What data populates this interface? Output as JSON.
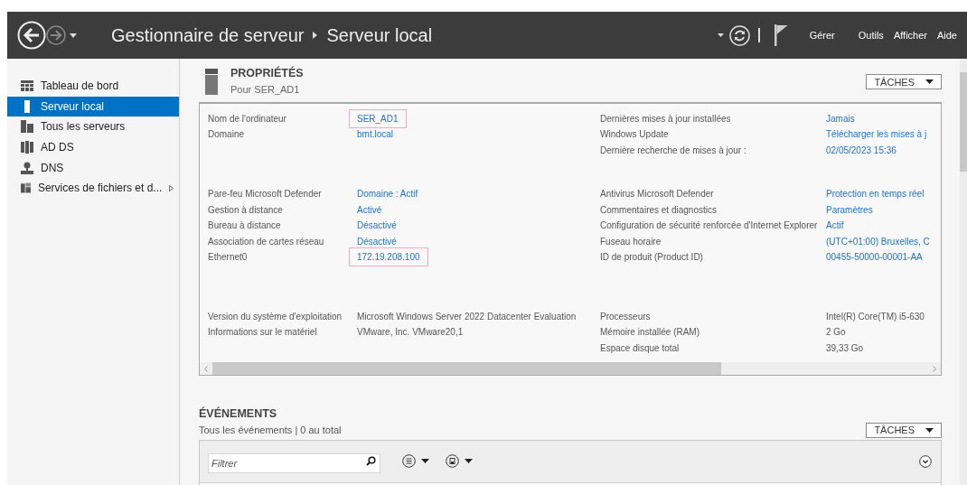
{
  "titlebar": {
    "breadcrumb": [
      "Gestionnaire de serveur",
      "Serveur local"
    ],
    "menu": [
      "Gérer",
      "Outils",
      "Afficher",
      "Aide"
    ]
  },
  "sidebar": {
    "items": [
      {
        "label": "Tableau de bord",
        "kind": "dashboard",
        "selected": false,
        "submenu": false
      },
      {
        "label": "Serveur local",
        "kind": "server",
        "selected": true,
        "submenu": false
      },
      {
        "label": "Tous les serveurs",
        "kind": "servers",
        "selected": false,
        "submenu": false
      },
      {
        "label": "AD DS",
        "kind": "adds",
        "selected": false,
        "submenu": false
      },
      {
        "label": "DNS",
        "kind": "dns",
        "selected": false,
        "submenu": false
      },
      {
        "label": "Services de fichiers et d...",
        "kind": "files",
        "selected": false,
        "submenu": true
      }
    ]
  },
  "properties": {
    "title": "PROPRIÉTÉS",
    "subtitle": "Pour SER_AD1",
    "tasks_button": "TÂCHES",
    "sections": [
      {
        "left": [
          {
            "label": "Nom de l'ordinateur",
            "value": "SER_AD1",
            "link": true,
            "highlighted": true
          },
          {
            "label": "Domaine",
            "value": "bmt.local",
            "link": true,
            "highlighted": false
          }
        ],
        "right": [
          {
            "label": "Dernières mises à jour installées",
            "value": "Jamais",
            "link": true,
            "highlighted": false
          },
          {
            "label": "Windows Update",
            "value": "Télécharger les mises à j",
            "link": true,
            "highlighted": false
          },
          {
            "label": "Dernière recherche de mises à jour :",
            "value": "02/05/2023 15:36",
            "link": true,
            "highlighted": false
          }
        ]
      },
      {
        "left": [
          {
            "label": "Pare-feu Microsoft Defender",
            "value": "Domaine : Actif",
            "link": true,
            "highlighted": false
          },
          {
            "label": "Gestion à distance",
            "value": "Activé",
            "link": true,
            "highlighted": false
          },
          {
            "label": "Bureau à distance",
            "value": "Désactivé",
            "link": true,
            "highlighted": false
          },
          {
            "label": "Association de cartes réseau",
            "value": "Désactivé",
            "link": true,
            "highlighted": false
          },
          {
            "label": "Ethernet0",
            "value": "172.19.208.100",
            "link": true,
            "highlighted": true
          }
        ],
        "right": [
          {
            "label": "Antivirus Microsoft Defender",
            "value": "Protection en temps réel",
            "link": true,
            "highlighted": false
          },
          {
            "label": "Commentaires et diagnostics",
            "value": "Paramètres",
            "link": true,
            "highlighted": false
          },
          {
            "label": "Configuration de sécurité renforcée d'Internet Explorer",
            "value": "Actif",
            "link": true,
            "highlighted": false
          },
          {
            "label": "Fuseau horaire",
            "value": "(UTC+01:00) Bruxelles, C",
            "link": true,
            "highlighted": false
          },
          {
            "label": "ID de produit (Product ID)",
            "value": "00455-50000-00001-AA",
            "link": true,
            "highlighted": false
          }
        ]
      },
      {
        "left": [
          {
            "label": "Version du système d'exploitation",
            "value": "Microsoft Windows Server 2022 Datacenter Evaluation",
            "link": false,
            "highlighted": false
          },
          {
            "label": "Informations sur le matériel",
            "value": "VMware, Inc. VMware20,1",
            "link": false,
            "highlighted": false
          }
        ],
        "right": [
          {
            "label": "Processeurs",
            "value": "Intel(R) Core(TM) i5-630",
            "link": false,
            "highlighted": false
          },
          {
            "label": "Mémoire installée (RAM)",
            "value": "2 Go",
            "link": false,
            "highlighted": false
          },
          {
            "label": "Espace disque total",
            "value": "39,33 Go",
            "link": false,
            "highlighted": false
          }
        ]
      }
    ]
  },
  "events": {
    "title": "ÉVÉNEMENTS",
    "subtitle": "Tous les événements | 0 au total",
    "tasks_button": "TÂCHES",
    "filter": {
      "placeholder": "Filtrer"
    }
  }
}
